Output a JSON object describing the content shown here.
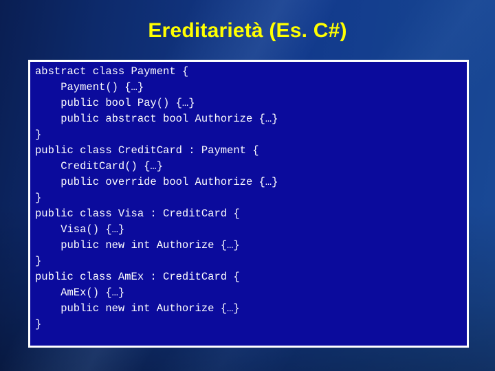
{
  "slide": {
    "title": "Ereditarietà (Es. C#)",
    "title_color": "#ffff00",
    "background_color": "#123a8c",
    "code_box": {
      "fill_color": "#0b0b9c",
      "border_color": "#ffffff",
      "text_color": "#ffffff",
      "language": "C#",
      "lines": [
        "abstract class Payment {",
        "    Payment() {…}",
        "    public bool Pay() {…}",
        "    public abstract bool Authorize {…}",
        "}",
        "public class CreditCard : Payment {",
        "    CreditCard() {…}",
        "    public override bool Authorize {…}",
        "}",
        "public class Visa : CreditCard {",
        "    Visa() {…}",
        "    public new int Authorize {…}",
        "}",
        "public class AmEx : CreditCard {",
        "    AmEx() {…}",
        "    public new int Authorize {…}",
        "}"
      ]
    }
  }
}
